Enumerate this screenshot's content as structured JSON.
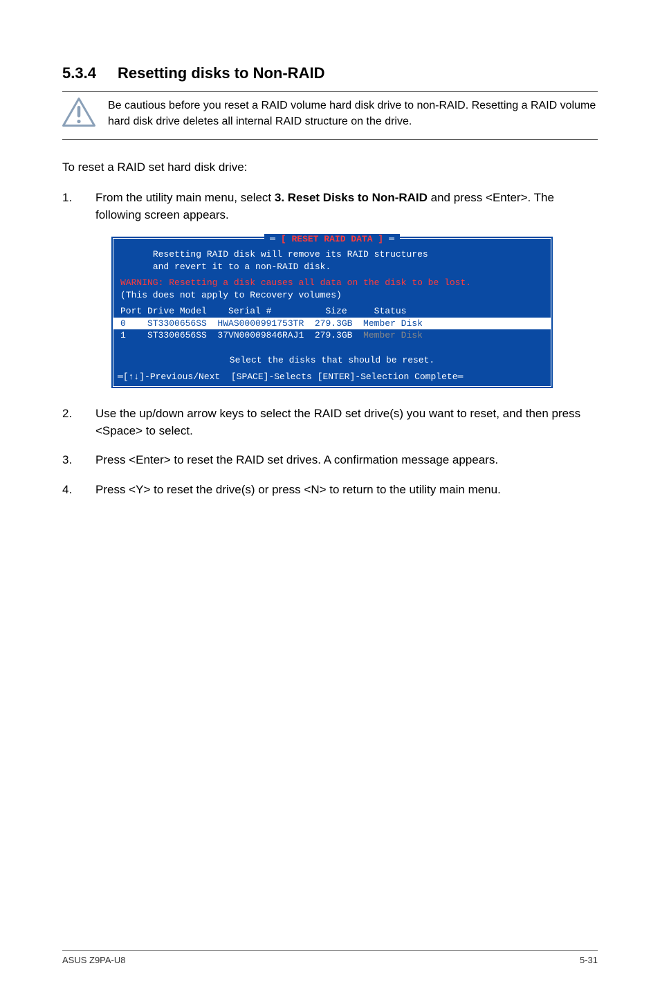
{
  "section": {
    "number": "5.3.4",
    "title": "Resetting disks to Non-RAID"
  },
  "caution": "Be cautious before you reset a RAID volume hard disk drive to non-RAID. Resetting a RAID volume hard disk drive deletes all internal RAID structure on the drive.",
  "intro": "To reset a RAID set hard disk drive:",
  "steps": [
    {
      "n": "1.",
      "pre": "From the utility main menu, select ",
      "bold": "3. Reset Disks to Non-RAID",
      "post": " and press <Enter>. The following screen appears."
    },
    {
      "n": "2.",
      "text": "Use the up/down arrow keys to select the RAID set drive(s) you want to reset, and then press <Space> to select."
    },
    {
      "n": "3.",
      "text": "Press <Enter> to reset the RAID set drives. A confirmation message appears."
    },
    {
      "n": "4.",
      "text": "Press <Y> to reset the drive(s) or press <N> to return to the utility main menu."
    }
  ],
  "terminal": {
    "title": "[ RESET RAID DATA ]",
    "msg1": "Resetting RAID disk will remove its RAID structures",
    "msg2": "and revert it to a non-RAID disk.",
    "warn": "WARNING: Resetting a disk causes all data on the disk to be lost.",
    "note": "(This does not apply to Recovery volumes)",
    "header": "Port Drive Model    Serial #          Size     Status",
    "rows": [
      {
        "text": "0    ST3300656SS  HWAS0000991753TR  279.3GB  Member Disk",
        "selected": true
      },
      {
        "text": "1    ST3300656SS  37VN00009846RAJ1  279.3GB  Member Disk",
        "selected": false,
        "dimStatus": true
      }
    ],
    "prompt": "Select the disks that should be reset.",
    "footer": "[↑↓]-Previous/Next  [SPACE]-Selects [ENTER]-Selection Complete"
  },
  "footer": {
    "left": "ASUS Z9PA-U8",
    "right": "5-31"
  }
}
